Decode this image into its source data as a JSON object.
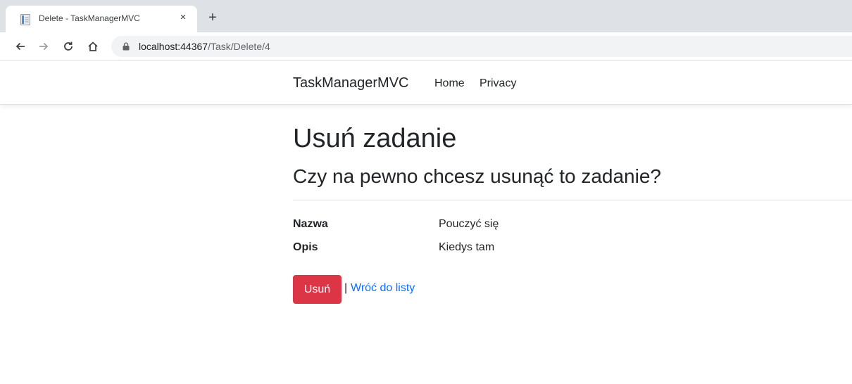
{
  "browser": {
    "tab_title": "Delete - TaskManagerMVC",
    "tab_close": "×",
    "new_tab": "+",
    "icons": {
      "back": "arrow-left-icon",
      "forward": "arrow-right-icon",
      "reload": "reload-icon",
      "home": "home-icon",
      "lock": "lock-icon",
      "favicon": "page-icon"
    },
    "url_host": "localhost:44367",
    "url_path": "/Task/Delete/4"
  },
  "navbar": {
    "brand": "TaskManagerMVC",
    "links": [
      "Home",
      "Privacy"
    ]
  },
  "main": {
    "title": "Usuń zadanie",
    "subtitle": "Czy na pewno chcesz usunąć to zadanie?",
    "fields": [
      {
        "label": "Nazwa",
        "value": "Pouczyć się"
      },
      {
        "label": "Opis",
        "value": "Kiedys tam"
      }
    ],
    "delete_label": "Usuń",
    "separator": "|",
    "back_label": "Wróć do listy"
  },
  "colors": {
    "danger": "#dc3545",
    "link": "#0d6efd",
    "tabstrip": "#dee1e6",
    "omnibox": "#f1f3f4"
  }
}
